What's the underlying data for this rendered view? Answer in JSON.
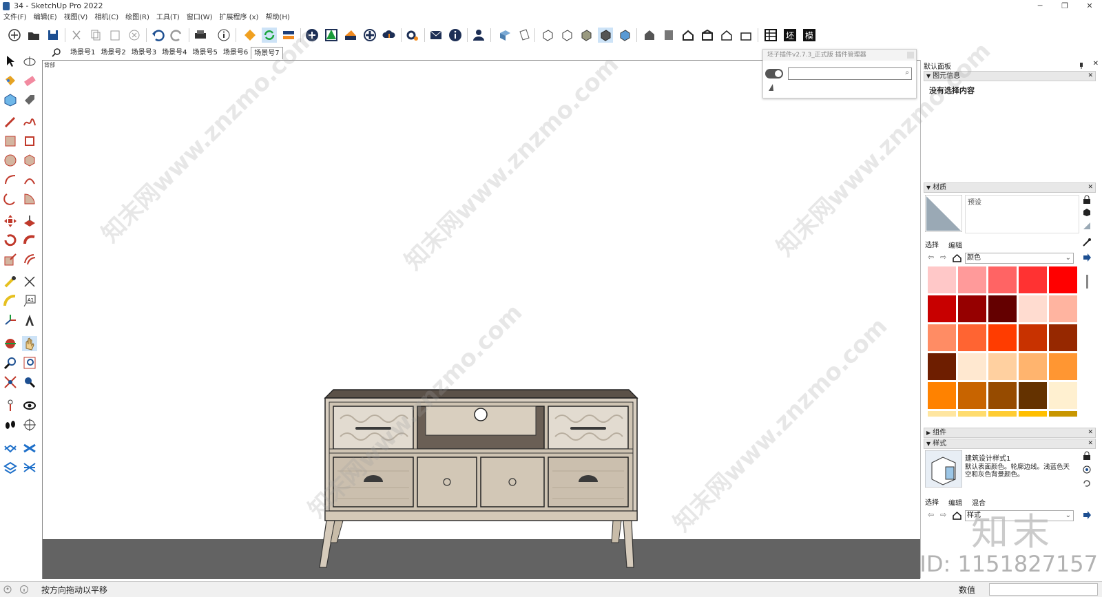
{
  "window": {
    "title": "34 - SketchUp Pro 2022",
    "min": "─",
    "max": "❐",
    "close": "✕"
  },
  "menu": [
    "文件(F)",
    "编辑(E)",
    "视图(V)",
    "相机(C)",
    "绘图(R)",
    "工具(T)",
    "窗口(W)",
    "扩展程序 (x)",
    "帮助(H)"
  ],
  "scenes": {
    "search_icon": "search-icon",
    "tabs": [
      "场景号1",
      "场景号2",
      "场景号3",
      "场景号4",
      "场景号5",
      "场景号6",
      "场景号7"
    ],
    "active_index": 6
  },
  "viewport": {
    "view_label": "背部",
    "ground_color": "#636363",
    "sky_color": "#ffffff"
  },
  "plugin_manager": {
    "title": "坯子插件v2.7.3_正式版 插件管理器",
    "search_value": ""
  },
  "tray": {
    "title": "默认面板",
    "entity_info": {
      "header": "图元信息",
      "text": "没有选择内容"
    },
    "materials": {
      "header": "材质",
      "preset_label": "预设",
      "select_tab": "选择",
      "edit_tab": "编辑",
      "library": "颜色",
      "swatches": [
        "#ffc8c8",
        "#ff9a9a",
        "#ff6464",
        "#ff3232",
        "#ff0000",
        "#c80000",
        "#960000",
        "#640000",
        "#ffdcd0",
        "#ffb4a0",
        "#ff8c64",
        "#ff6432",
        "#ff3c00",
        "#c83200",
        "#962800",
        "#6e1e00",
        "#ffe8d0",
        "#ffd0a0",
        "#ffb46e",
        "#ff9632",
        "#ff8200",
        "#c86400",
        "#964b00",
        "#643200",
        "#fff0d0",
        "#ffe6a0",
        "#ffdc6e",
        "#ffcc32",
        "#ffbf00",
        "#c89600"
      ]
    },
    "components": {
      "header": "组件"
    },
    "styles": {
      "header": "样式",
      "style_name": "建筑设计样式1",
      "style_desc": "默认表面颜色。轮廓边线。浅蓝色天空和灰色背景颜色。",
      "select_tab": "选择",
      "edit_tab": "编辑",
      "mix_tab": "混合",
      "dropdown": "样式"
    }
  },
  "status": {
    "hint": "按方向拖动以平移",
    "measure_label": "数值",
    "measure_value": ""
  },
  "watermark": {
    "text": "知末网www.znzmo.com",
    "brand": "知末",
    "id_text": "ID: 1151827157"
  },
  "colors": {
    "accent": "#1a6fc9",
    "wood_light": "#d9cfc1",
    "wood_dark": "#5b5148",
    "floor": "#636363"
  }
}
